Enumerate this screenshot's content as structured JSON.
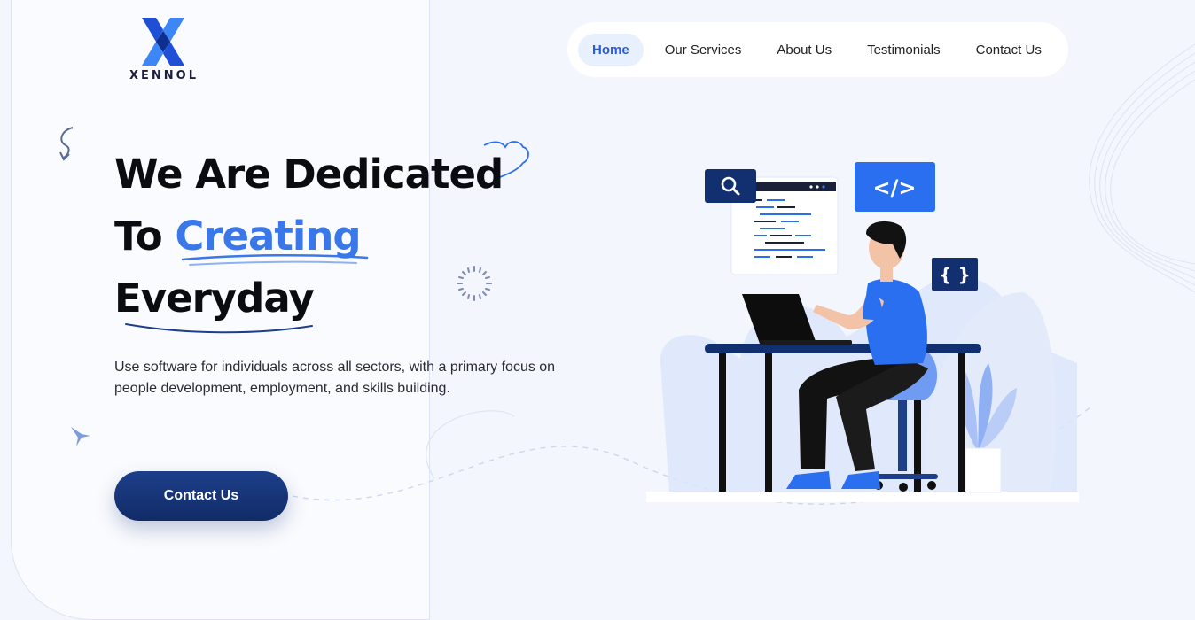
{
  "brand": {
    "name": "XENNOL"
  },
  "nav": {
    "items": [
      {
        "label": "Home",
        "active": true
      },
      {
        "label": "Our Services",
        "active": false
      },
      {
        "label": "About Us",
        "active": false
      },
      {
        "label": "Testimonials",
        "active": false
      },
      {
        "label": "Contact Us",
        "active": false
      }
    ]
  },
  "hero": {
    "title_line1": "We Are Dedicated",
    "title_line2_prefix": "To ",
    "title_line2_accent": "Creating",
    "title_line3": "Everyday",
    "description": "Use software for individuals across all sectors, with a primary focus on people development, employment, and skills building.",
    "cta_label": "Contact Us"
  },
  "illustration": {
    "code_tag": "</>",
    "braces_tag": "{ }"
  },
  "colors": {
    "accent": "#3a78ea",
    "primary_dark": "#112b66",
    "nav_active_bg": "#e8effd",
    "illustration_blue": "#2a6ff0",
    "illustration_navy": "#123070"
  },
  "icons": [
    "xennol-logo-icon",
    "search-icon",
    "code-icon",
    "braces-icon",
    "curly-arrow-icon",
    "sparkle-icon",
    "star-icon",
    "swirl-icon"
  ]
}
